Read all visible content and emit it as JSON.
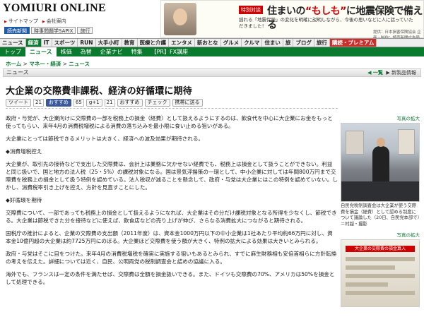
{
  "header": {
    "logo": "YOMIURI ONLINE",
    "links": [
      "サイトマップ",
      "会社案内"
    ],
    "mini_buttons": [
      "読売新聞",
      "時事問題学SAPIX",
      "旅行"
    ]
  },
  "ad": {
    "tag": "特別対談",
    "headline_pre": "住まいの",
    "headline_em": "“もしも”",
    "headline_post": "に地震保険で備える",
    "sub": "揺れる「地震保険」の変化を明確に説明しながら、今後の思いなどに人に話っていただきました！",
    "sponsor": "提供：日本損害保険協会 企画・制作：読売新聞広告局"
  },
  "nav_main": [
    "ニュース",
    "経済",
    "IT",
    "スポーツ",
    "RUN",
    "大手小町",
    "教育",
    "医療と介護",
    "エンタメ",
    "新おとな",
    "グルメ",
    "クルマ",
    "住まい",
    "旅",
    "ブログ",
    "旅行",
    "購読・プレミアム"
  ],
  "nav_sub": [
    "トップ",
    "ニュース",
    "株価",
    "為替",
    "企業ナビ",
    "特集",
    "【PR】FX講座"
  ],
  "breadcrumb": {
    "home": "ホーム",
    "sep1": " > ",
    "mid": "マネー・経済",
    "sep2": " > ",
    "last": "ニュース"
  },
  "section": {
    "label": "ニュース",
    "prev": "◀ 一覧",
    "next": "▶ 新製品情報"
  },
  "article": {
    "title": "大企業の交際費非課税、経済の好循環に期待",
    "tweet": "ツイート",
    "tweet_count": "21",
    "fb": "おすすめ",
    "fb_count": "65",
    "g_count": "21",
    "share": "おすすめ",
    "check": "チェック",
    "mobile": "携帯に送る",
    "paragraphs": [
      "政府・与党が、大企業向けに交際費の一部を税務上の損金（経費）として扱えるようにするのは、飲食代を中心に大企業にお金をもっと使ってもらい、来年4月の消費税増税による消費の落ち込みを最小限に食い止める狙いがある。",
      "大企業にとっては節税できるメリットは大きく、経済への波及効果が期待される。",
      "◆消費増税控え",
      "大企業が、取引先の接待などで支出した交際費は、会計上は業務に欠かせない経費でも、税務上は損金として扱うことができない。利益と同じ扱いで、国と地方の法人税（25・5%）の課税対象になる。国は景気浮揚策の一環として、中小企業に対しては年間800万円まで交際費を税務上の損金として扱う特例を認めている。法人税収が減ることを懸念して、政府・与党は大企業にはこの特例を認めていない。しかし、消費税率引き上げを控え、方針を見直すことにした。",
      "◆好循環を期待",
      "交際費について、一部であっても税務上の損金として扱えるようになれば、大企業はその分だけ課税対象となる所得を少なくし、節税できる。大企業は節税できた分を接待などに使えば、飲食店などの売り上げが伸び、さらなる消費拡大につながると期待される。",
      "国税庁の推計によると、企業の交際費の支出額（2011年度）は、資本金1000万円以下の中小企業は1社あたり平均約66万円に対し、資本金10億円超の大企業は約7725万円にのぼる。大企業ほど交際費を使う額が大きく、特例の拡大による効果は大きいとみられる。",
      "政府・与党はそこに目をつけた。来年4月の消費税増税を確実に実施する狙いもあるとみられ、すでに麻生財務相も安倍首相らに方針転換の考えを伝えた。詳細については近く、自民、公明両党の税制調査会と詰めの協議に入る。",
      "海外でも、フランスは一定の条件を満たせば、交際費は全額を損金扱いできる。また、ドイツも交際費の70%、アメリカは50%を損金として処理できる。"
    ]
  },
  "sidebar": {
    "photo_link": "写真の拡大",
    "caption": "自民党税制調査会は大企業が使う交際費を損金（経費）として認める制度について議論した（20日、自民党本部で）＝村越・撮影",
    "photo_link2": "写真の拡大",
    "photo2_title": "大企業の交際費の損金算入"
  }
}
